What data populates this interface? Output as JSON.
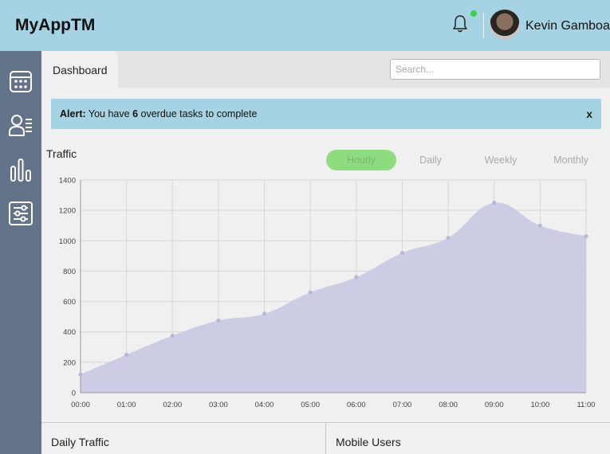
{
  "header": {
    "logo": "MyAppTM",
    "user_name": "Kevin Gamboa",
    "notification_dot_color": "#35d649"
  },
  "sidebar": {
    "items": [
      {
        "icon": "calendar-icon"
      },
      {
        "icon": "members-icon"
      },
      {
        "icon": "bar-chart-icon"
      },
      {
        "icon": "settings-sliders-icon"
      }
    ]
  },
  "tabs": {
    "active": "Dashboard"
  },
  "search": {
    "placeholder": "Search..."
  },
  "alert": {
    "label": "Alert:",
    "prefix": "You have",
    "count": "6",
    "suffix": "overdue tasks to complete",
    "close": "x"
  },
  "traffic": {
    "title": "Traffic",
    "periods": [
      "Hourly",
      "Daily",
      "Weekly",
      "Monthly"
    ],
    "active_period": "Hourly"
  },
  "chart_data": {
    "type": "area",
    "title": "",
    "x": [
      "00:00",
      "01:00",
      "02:00",
      "03:00",
      "04:00",
      "05:00",
      "06:00",
      "07:00",
      "08:00",
      "09:00",
      "10:00",
      "11:00"
    ],
    "series": [
      {
        "values": [
          120,
          250,
          375,
          475,
          520,
          660,
          760,
          920,
          1020,
          1250,
          1100,
          1030
        ]
      }
    ],
    "ylim": [
      0,
      1400
    ],
    "yticks": [
      0,
      200,
      400,
      600,
      800,
      1000,
      1200,
      1400
    ],
    "grid": true,
    "fill_color": "#c8c8e2",
    "point_color": "#b6b6d6"
  },
  "panels": {
    "daily_traffic": "Daily Traffic",
    "mobile_users": "Mobile Users"
  }
}
